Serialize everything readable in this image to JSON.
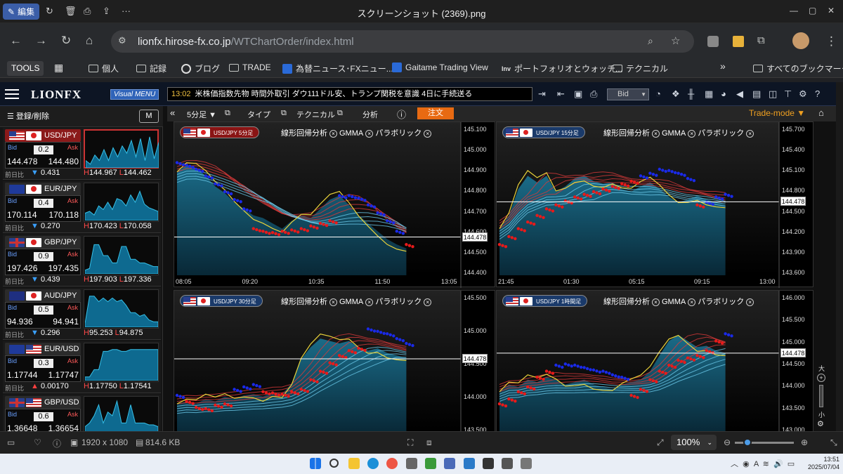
{
  "viewer": {
    "edit_label": "編集",
    "title": "スクリーンショット (2369).png",
    "file_dims": "1920 x 1080",
    "file_size": "814.6 KB",
    "zoom": "100%"
  },
  "browser": {
    "url_host": "lionfx.hirose-fx.co.jp",
    "url_path": "/WTChartOrder/index.html",
    "bookmarks": [
      "TOOLS",
      "個人",
      "記録",
      "ブログ",
      "TRADE",
      "為替ニュース･FXニュー...",
      "Gaitame Trading View",
      "ポートフォリオとウォッチ...",
      "テクニカル",
      "すべてのブックマーク"
    ]
  },
  "app": {
    "logo": "LIONFX",
    "visual_menu": "Visual MENU",
    "ticker_time": "13:02",
    "ticker_text": "米株価指数先物 時間外取引 ダウ111ドル安、トランプ関税を意識 4日に手続送る",
    "bid_select": "Bid",
    "register_label": "登録/削除",
    "trade_mode": "Trade-mode ▼",
    "order_btn": "注文",
    "toolbar": {
      "timeframe": "5分足",
      "type": "タイプ",
      "technical": "テクニカル",
      "analysis": "分析"
    }
  },
  "rates": [
    {
      "pair": "USD/JPY",
      "spread": "0.2",
      "bid": "144.478",
      "ask": "144.480",
      "chg_label": "前日比",
      "chg": "0.431",
      "dir": "down",
      "high": "144.967",
      "low": "144.462",
      "spark": [
        0.2,
        0.1,
        0.35,
        0.2,
        0.5,
        0.2,
        0.55,
        0.3,
        0.6,
        0.4,
        0.75,
        0.3,
        0.8,
        0.2,
        0.85,
        0.25,
        0.7
      ]
    },
    {
      "pair": "EUR/JPY",
      "spread": "0.4",
      "bid": "170.114",
      "ask": "170.118",
      "chg_label": "前日比",
      "chg": "0.270",
      "dir": "down",
      "high": "170.423",
      "low": "170.058",
      "spark": [
        0.2,
        0.25,
        0.15,
        0.4,
        0.3,
        0.5,
        0.3,
        0.6,
        0.55,
        0.4,
        0.7,
        0.5,
        0.8,
        0.45,
        0.35,
        0.3,
        0.25
      ]
    },
    {
      "pair": "GBP/JPY",
      "spread": "0.9",
      "bid": "197.426",
      "ask": "197.435",
      "chg_label": "前日比",
      "chg": "0.439",
      "dir": "down",
      "high": "197.903",
      "low": "197.336",
      "spark": [
        0.1,
        0.15,
        0.8,
        0.8,
        0.5,
        0.5,
        0.3,
        0.3,
        0.75,
        0.75,
        0.4,
        0.4,
        0.3,
        0.3,
        0.25,
        0.2,
        0.2
      ]
    },
    {
      "pair": "AUD/JPY",
      "spread": "0.5",
      "bid": "94.936",
      "ask": "94.941",
      "chg_label": "前日比",
      "chg": "0.296",
      "dir": "down",
      "high": "95.253",
      "low": "94.875",
      "spark": [
        0.1,
        0.85,
        0.85,
        0.7,
        0.8,
        0.7,
        0.8,
        0.7,
        0.75,
        0.6,
        0.4,
        0.4,
        0.3,
        0.35,
        0.2,
        0.15,
        0.15
      ]
    },
    {
      "pair": "EUR/USD",
      "spread": "0.3",
      "bid": "1.17744",
      "ask": "1.17747",
      "chg_label": "前日比",
      "chg": "0.00170",
      "dir": "up",
      "high": "1.17750",
      "low": "1.17541",
      "spark": [
        0.1,
        0.1,
        0.3,
        0.3,
        0.8,
        0.8,
        0.85,
        0.85,
        0.8,
        0.8,
        0.85,
        0.85,
        0.85,
        0.85,
        0.85,
        0.85,
        0.85
      ]
    },
    {
      "pair": "GBP/USD",
      "spread": "0.6",
      "bid": "1.36648",
      "ask": "1.36654",
      "chg_label": "",
      "chg": "",
      "dir": "none",
      "high": "",
      "low": "",
      "spark": [
        0.2,
        0.3,
        0.5,
        0.8,
        0.3,
        0.6,
        0.5,
        0.9,
        0.3,
        0.3,
        0.8,
        0.3,
        0.3,
        0.3,
        0.25,
        0.25,
        0.2
      ]
    }
  ],
  "panels": [
    {
      "tag": "USD/JPY 5分足",
      "tag_color": "#8a1414",
      "indicators": [
        "線形回帰分析",
        "GMMA",
        "パラボリック"
      ],
      "y_labels": [
        "145.100",
        "145.000",
        "144.900",
        "144.800",
        "144.700",
        "144.600",
        "144.500",
        "144.400"
      ],
      "x_labels": [
        "08:05",
        "09:20",
        "10:35",
        "11:50",
        "13:05"
      ],
      "price": "144.478",
      "price_path": [
        0.27,
        0.22,
        0.24,
        0.3,
        0.38,
        0.43,
        0.5,
        0.55,
        0.6,
        0.62,
        0.66,
        0.7,
        0.64,
        0.6,
        0.62,
        0.55,
        0.48,
        0.45,
        0.52,
        0.6,
        0.66,
        0.72,
        0.78,
        0.82,
        0.85
      ],
      "psar": [
        0.2,
        0.22,
        0.25,
        0.3,
        0.36,
        0.42,
        0.48,
        0.55,
        0.7,
        0.72,
        0.73,
        0.72,
        0.71,
        0.7,
        0.68,
        0.66,
        0.64,
        0.45,
        0.45,
        0.47,
        0.52,
        0.58,
        0.64,
        0.72,
        0.82
      ],
      "psar_side": [
        1,
        1,
        1,
        1,
        1,
        1,
        1,
        1,
        0,
        0,
        0,
        0,
        0,
        0,
        0,
        0,
        0,
        1,
        1,
        1,
        1,
        1,
        1,
        1,
        0
      ]
    },
    {
      "tag": "USD/JPY 15分足",
      "tag_color": "#1a3a6a",
      "indicators": [
        "線形回帰分析",
        "GMMA",
        "パラボリック"
      ],
      "y_labels": [
        "145.700",
        "145.400",
        "145.100",
        "144.800",
        "144.500",
        "144.200",
        "143.900",
        "143.600"
      ],
      "x_labels": [
        "21:45",
        "01:30",
        "05:15",
        "09:15",
        "13:00"
      ],
      "price": "144.478",
      "price_path": [
        0.7,
        0.6,
        0.4,
        0.3,
        0.35,
        0.3,
        0.42,
        0.38,
        0.32,
        0.3,
        0.34,
        0.36,
        0.35,
        0.4,
        0.42,
        0.38,
        0.35,
        0.4,
        0.46,
        0.5,
        0.48,
        0.45,
        0.48,
        0.5,
        0.52
      ],
      "psar": [
        0.82,
        0.76,
        0.7,
        0.65,
        0.6,
        0.55,
        0.52,
        0.49,
        0.46,
        0.44,
        0.42,
        0.4,
        0.38,
        0.36,
        0.34,
        0.3,
        0.28,
        0.25,
        0.26,
        0.28,
        0.32,
        0.52,
        0.5,
        0.46,
        0.44
      ],
      "psar_side": [
        0,
        0,
        0,
        0,
        0,
        0,
        0,
        0,
        0,
        0,
        0,
        0,
        0,
        0,
        0,
        1,
        1,
        1,
        1,
        1,
        1,
        0,
        1,
        1,
        1
      ]
    },
    {
      "tag": "USD/JPY 30分足",
      "tag_color": "#1a3a6a",
      "indicators": [
        "線形回帰分析",
        "GMMA",
        "パラボリック"
      ],
      "y_labels": [
        "145.500",
        "145.000",
        "144.500",
        "144.000",
        "143.500"
      ],
      "x_labels": [],
      "price": "144.478",
      "price_path": [
        0.82,
        0.8,
        0.82,
        0.78,
        0.8,
        0.76,
        0.78,
        0.75,
        0.74,
        0.76,
        0.72,
        0.74,
        0.65,
        0.45,
        0.35,
        0.28,
        0.3,
        0.32,
        0.3,
        0.35,
        0.38,
        0.36,
        0.4,
        0.42,
        0.44
      ],
      "psar": [
        0.75,
        0.8,
        0.85,
        0.86,
        0.83,
        0.82,
        0.7,
        0.68,
        0.66,
        0.72,
        0.73,
        0.74,
        0.72,
        0.7,
        0.62,
        0.55,
        0.48,
        0.42,
        0.38,
        0.36,
        0.2,
        0.22,
        0.24,
        0.28,
        0.32
      ],
      "psar_side": [
        1,
        0,
        0,
        0,
        0,
        0,
        1,
        1,
        1,
        0,
        0,
        0,
        0,
        0,
        0,
        0,
        0,
        0,
        0,
        0,
        1,
        1,
        1,
        1,
        1
      ]
    },
    {
      "tag": "USD/JPY 1時間足",
      "tag_color": "#1a3a6a",
      "indicators": [
        "線形回帰分析",
        "GMMA",
        "パラボリック"
      ],
      "y_labels": [
        "146.000",
        "145.500",
        "145.000",
        "144.500",
        "144.000",
        "143.500",
        "143.000"
      ],
      "x_labels": [],
      "price": "144.478",
      "price_path": [
        0.72,
        0.66,
        0.68,
        0.62,
        0.64,
        0.6,
        0.62,
        0.66,
        0.64,
        0.62,
        0.66,
        0.68,
        0.7,
        0.66,
        0.64,
        0.62,
        0.55,
        0.42,
        0.3,
        0.25,
        0.3,
        0.35,
        0.34,
        0.38,
        0.4
      ],
      "psar": [
        0.82,
        0.78,
        0.72,
        0.68,
        0.6,
        0.55,
        0.5,
        0.49,
        0.5,
        0.52,
        0.54,
        0.55,
        0.58,
        0.6,
        0.75,
        0.7,
        0.62,
        0.55,
        0.5,
        0.46,
        0.44,
        0.42,
        0.38,
        0.3,
        0.24
      ],
      "psar_side": [
        0,
        0,
        0,
        0,
        0,
        0,
        1,
        1,
        1,
        1,
        1,
        1,
        1,
        1,
        0,
        0,
        0,
        0,
        0,
        0,
        0,
        0,
        0,
        0,
        1
      ]
    }
  ],
  "windows": {
    "date": "2025/07/04",
    "time": "13:51"
  },
  "colors": {
    "accent": "#e86a12",
    "bid_blue": "#3aa0ff",
    "ask_red": "#ff4040",
    "gmma": "#36a6c8"
  }
}
